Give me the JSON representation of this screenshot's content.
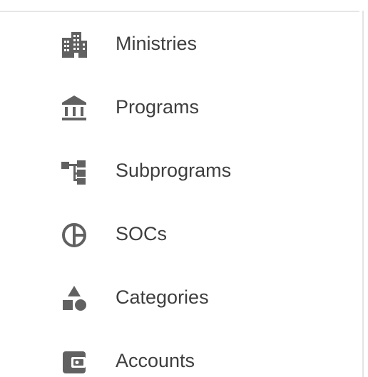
{
  "sidebar": {
    "items": [
      {
        "label": "Ministries",
        "icon": "building-icon"
      },
      {
        "label": "Programs",
        "icon": "bank-icon"
      },
      {
        "label": "Subprograms",
        "icon": "hierarchy-icon"
      },
      {
        "label": "SOCs",
        "icon": "pie-chart-icon"
      },
      {
        "label": "Categories",
        "icon": "shapes-icon"
      },
      {
        "label": "Accounts",
        "icon": "wallet-icon"
      }
    ]
  },
  "colors": {
    "icon": "#616161",
    "text": "#3e3e3e",
    "divider": "#e6e6e6"
  }
}
